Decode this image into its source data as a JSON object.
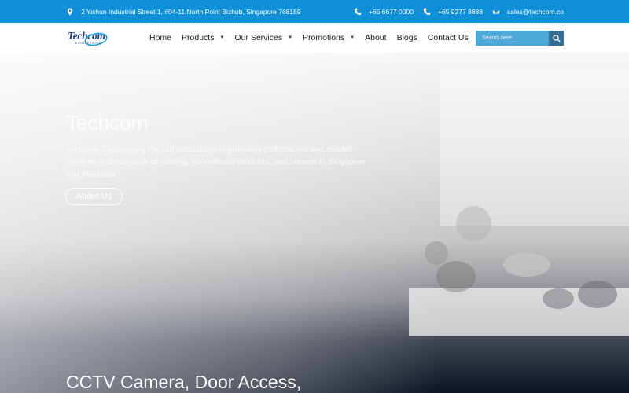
{
  "topbar": {
    "address": "2 Yishun Industrial Street 1, #04-11 North Point Bizhub, Singapore 768159",
    "phone1": "+65 6677 0000",
    "phone2": "+65 9277 8888",
    "email": "sales@techcom.co"
  },
  "logo": {
    "text": "Techcom",
    "tagline": "ENGINEERING"
  },
  "nav": {
    "home": "Home",
    "products": "Products",
    "services": "Our Services",
    "promotions": "Promotions",
    "about": "About",
    "blogs": "Blogs",
    "contact": "Contact Us"
  },
  "search": {
    "placeholder": "Search here..."
  },
  "hero": {
    "title": "Techcom",
    "description": "Techcom Engineering Pte Ltd specializes in providing professional and reliable services in areas such as cabling, surveillance products, and servers in Singapore and Malaysia",
    "button": "About Us",
    "heading": "CCTV Camera, Door Access,"
  },
  "colors": {
    "topbar": "#0e8fd8",
    "search_bg": "#4ea8d8",
    "search_btn": "#356f96",
    "logo": "#1c3e8c"
  }
}
